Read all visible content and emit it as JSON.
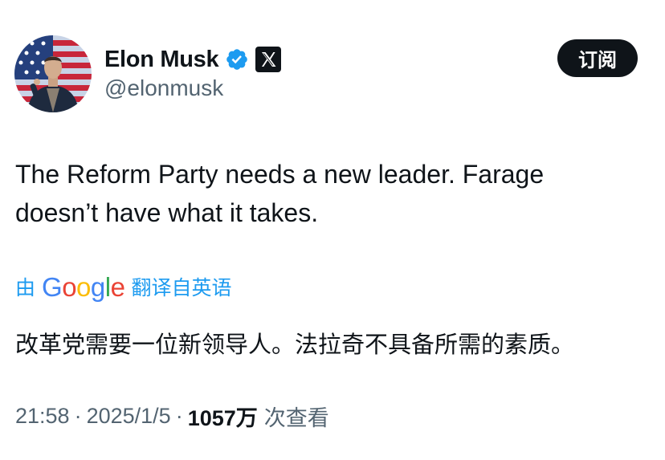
{
  "author": {
    "display_name": "Elon Musk",
    "handle": "@elonmusk"
  },
  "subscribe_label": "订阅",
  "tweet_text": "The Reform Party needs a new leader. Farage\ndoesn’t have what it takes.",
  "translation": {
    "prefix": "由",
    "provider": "Google",
    "suffix": "翻译自英语",
    "text": "改革党需要一位新领导人。法拉奇不具备所需的素质。"
  },
  "meta": {
    "time": "21:58",
    "separator": "·",
    "date": "2025/1/5",
    "views_count": "1057万",
    "views_label": "次查看"
  },
  "colors": {
    "link_blue": "#1d9bf0",
    "text_primary": "#0f1419",
    "text_secondary": "#536471",
    "button_bg": "#0f1419",
    "verified_blue": "#1d9bf0"
  },
  "icons": {
    "verified": "verified-badge-icon",
    "x_logo": "x-logo-icon"
  }
}
